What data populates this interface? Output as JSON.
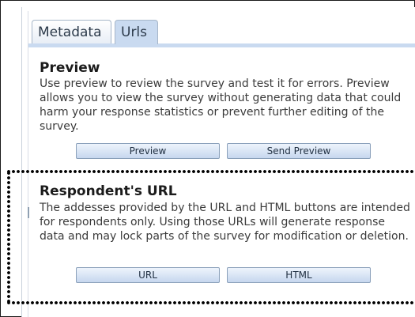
{
  "tabs": [
    {
      "label": "Metadata"
    },
    {
      "label": "Urls"
    }
  ],
  "preview": {
    "title": "Preview",
    "description": "Use preview to review the survey and test it for errors. Preview allows you to view the survey without generating data that could harm your response statistics or prevent further editing of the survey.",
    "preview_button": "Preview",
    "send_preview_button": "Send Preview"
  },
  "respondent": {
    "title": "Respondent's URL",
    "description": "The addesses provided by the URL and HTML buttons are intended for respondents only. Using those URLs will generate response data and may lock parts of the survey for modification or deletion.",
    "url_button": "URL",
    "html_button": "HTML"
  },
  "colors": {
    "tab_active": "#c9daf0",
    "button_border": "#8aa0ba",
    "highlight_border": "#000000"
  }
}
